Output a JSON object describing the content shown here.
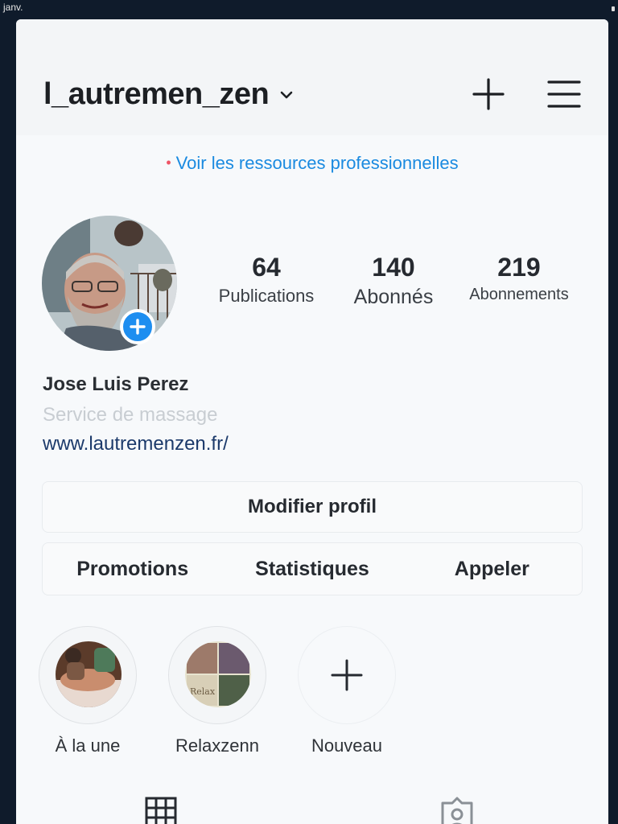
{
  "status_bar": {
    "date_fragment": "janv."
  },
  "header": {
    "username": "l_autremen_zen",
    "icons": [
      "chevron-down-icon",
      "plus-icon",
      "hamburger-menu-icon"
    ]
  },
  "pro_link": {
    "text": "Voir les ressources professionnelles"
  },
  "stats": [
    {
      "value": "64",
      "label": "Publications"
    },
    {
      "value": "140",
      "label": "Abonnés"
    },
    {
      "value": "219",
      "label": "Abonnements"
    }
  ],
  "profile": {
    "name": "Jose Luis Perez",
    "category": "Service de massage",
    "website": "www.lautremenzen.fr/"
  },
  "buttons": {
    "edit_profile": "Modifier profil",
    "row": [
      "Promotions",
      "Statistiques",
      "Appeler"
    ]
  },
  "highlights": [
    {
      "label": "À la une"
    },
    {
      "label": "Relaxzenn"
    },
    {
      "label": "Nouveau"
    }
  ],
  "colors": {
    "link_blue": "#1a8ae0",
    "badge_blue": "#1e8ef0",
    "notification_dot": "#ee5566"
  }
}
